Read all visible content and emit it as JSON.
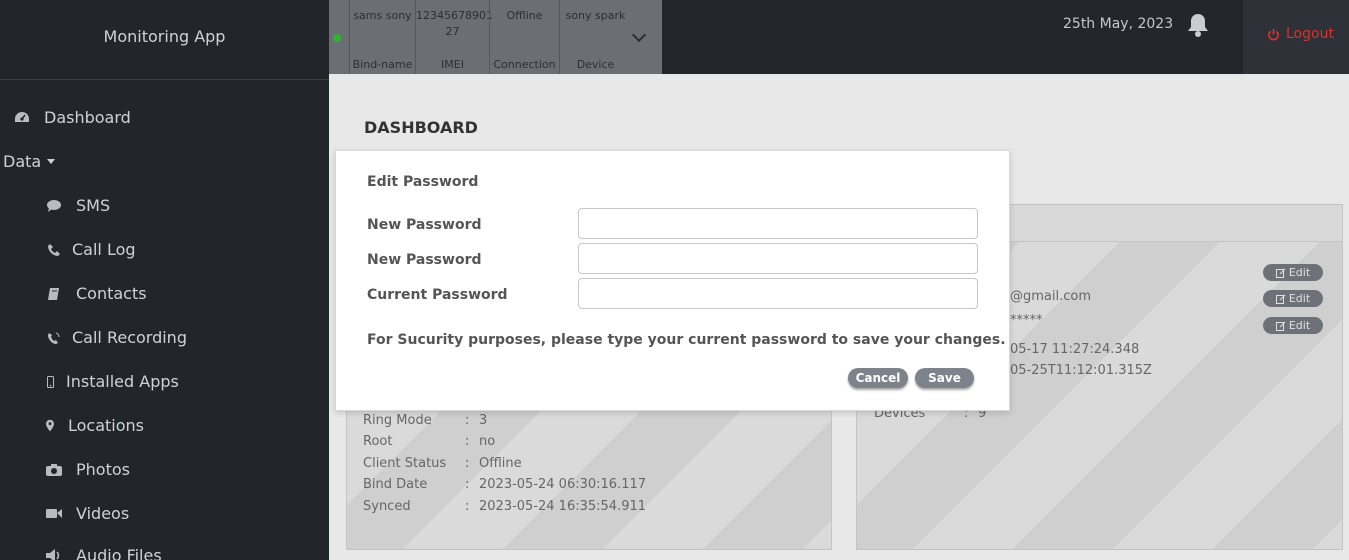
{
  "app": {
    "title": "Monitoring App"
  },
  "sidebar": {
    "dashboard": "Dashboard",
    "data_toggle": "Data",
    "items": [
      {
        "label": "SMS",
        "icon": "comment-icon"
      },
      {
        "label": "Call Log",
        "icon": "phone-icon"
      },
      {
        "label": "Contacts",
        "icon": "book-icon"
      },
      {
        "label": "Call Recording",
        "icon": "phone-volume-icon"
      },
      {
        "label": "Installed Apps",
        "icon": "mobile-icon"
      },
      {
        "label": "Locations",
        "icon": "map-marker-icon"
      },
      {
        "label": "Photos",
        "icon": "camera-icon"
      },
      {
        "label": "Videos",
        "icon": "video-icon"
      },
      {
        "label": "Audio Files",
        "icon": "volume-icon"
      }
    ]
  },
  "device": {
    "bind_name": "sams sony",
    "imei_line1": "12345678901",
    "imei_line2": "27",
    "connection": "Offline",
    "device": "sony spark",
    "headers": {
      "bind_name": "Bind-name",
      "imei": "IMEI",
      "connection": "Connection",
      "device": "Device"
    },
    "status_color": "#2db52d"
  },
  "header": {
    "date": "25th May, 2023",
    "logout": "Logout",
    "logout_color": "#d9312b"
  },
  "page": {
    "title": "DASHBOARD"
  },
  "device_info": [
    {
      "label": "Ring Mode",
      "value": "3"
    },
    {
      "label": "Root",
      "value": "no"
    },
    {
      "label": "Client Status",
      "value": "Offline"
    },
    {
      "label": "Bind Date",
      "value": "2023-05-24 06:30:16.117"
    },
    {
      "label": "Synced",
      "value": "2023-05-24 16:35:54.911"
    }
  ],
  "account": {
    "email_partial": "@gmail.com",
    "password_mask": "*****",
    "created_partial": "05-17 11:27:24.348",
    "updated_partial": "05-25T11:12:01.315Z",
    "devices_label": "Devices",
    "devices_value": "9",
    "edit_label": "Edit"
  },
  "modal": {
    "title": "Edit Password",
    "fields": [
      {
        "label": "New Password",
        "value": "",
        "placeholder": ""
      },
      {
        "label": "New Password",
        "value": "",
        "placeholder": ""
      },
      {
        "label": "Current Password",
        "value": "",
        "placeholder": ""
      }
    ],
    "note": "For Sucurity purposes, please type your current password to save your changes.",
    "cancel": "Cancel",
    "save": "Save"
  }
}
